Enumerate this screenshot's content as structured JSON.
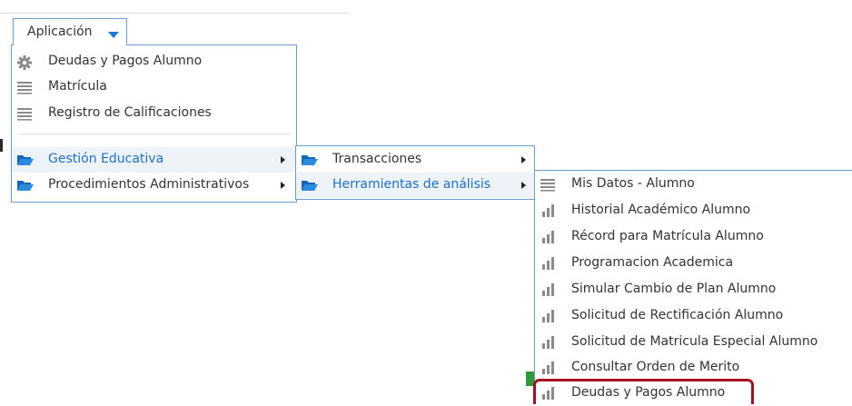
{
  "app_menu": {
    "label": "Aplicación",
    "accent_color": "#1e78d2"
  },
  "menu1": {
    "items": [
      {
        "label": "Deudas y Pagos Alumno",
        "icon": "gear-icon"
      },
      {
        "label": "Matrícula",
        "icon": "list-icon"
      },
      {
        "label": "Registro de Calificaciones",
        "icon": "list-icon"
      },
      {
        "label": "Gestión Educativa",
        "icon": "folder-icon",
        "active": true
      },
      {
        "label": "Procedimientos Administrativos",
        "icon": "folder-icon"
      }
    ]
  },
  "menu2": {
    "items": [
      {
        "label": "Transacciones",
        "icon": "folder-icon"
      },
      {
        "label": "Herramientas de análisis",
        "icon": "folder-icon",
        "active": true
      }
    ]
  },
  "menu3": {
    "items": [
      {
        "label": "Mis Datos - Alumno",
        "icon": "list-icon"
      },
      {
        "label": "Historial Académico Alumno",
        "icon": "bar-chart-icon"
      },
      {
        "label": "Récord para Matrícula Alumno",
        "icon": "bar-chart-icon"
      },
      {
        "label": "Programacion Academica",
        "icon": "bar-chart-icon"
      },
      {
        "label": "Simular Cambio de Plan Alumno",
        "icon": "bar-chart-icon"
      },
      {
        "label": "Solicitud de Rectificación Alumno",
        "icon": "bar-chart-icon"
      },
      {
        "label": "Solicitud de Matricula Especial Alumno",
        "icon": "bar-chart-icon"
      },
      {
        "label": "Consultar Orden de Merito",
        "icon": "bar-chart-icon"
      },
      {
        "label": "Deudas y Pagos Alumno",
        "icon": "bar-chart-icon",
        "highlighted": true
      }
    ]
  },
  "colors": {
    "menu_border": "#6b9bd2",
    "active_text": "#1e70c9",
    "highlight_border": "#a3121e"
  }
}
